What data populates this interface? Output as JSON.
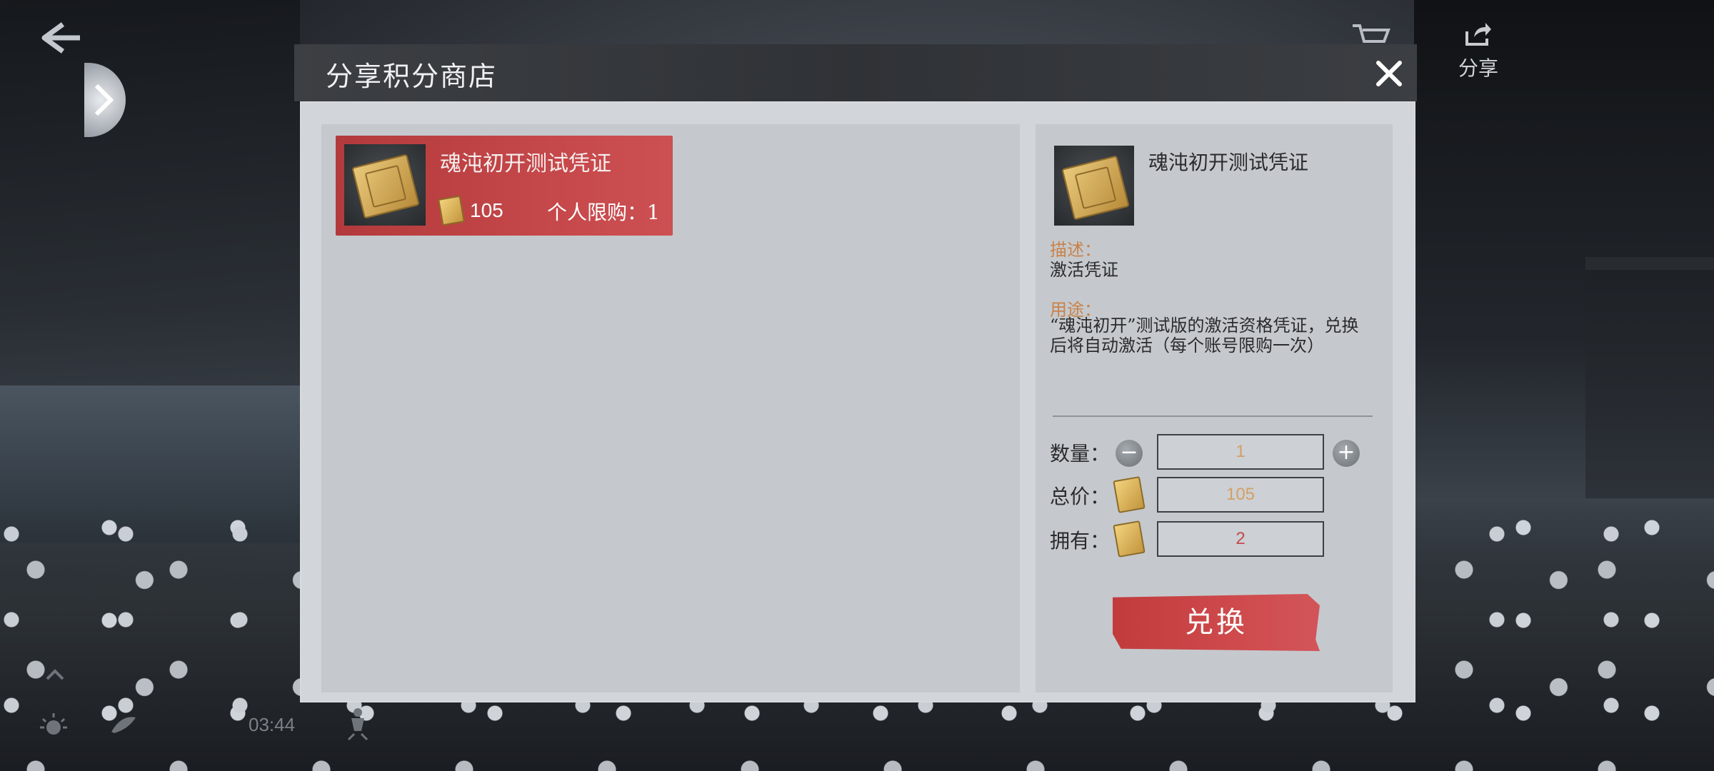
{
  "hud": {
    "share_label": "分享",
    "timer": "03:44"
  },
  "dialog": {
    "title": "分享积分商店",
    "items": [
      {
        "name": "魂沌初开测试凭证",
        "price": "105",
        "limit": "个人限购：1"
      }
    ]
  },
  "detail": {
    "name": "魂沌初开测试凭证",
    "desc_label": "描述：",
    "desc_text": "激活凭证",
    "use_label": "用途：",
    "use_text": "“魂沌初开”测试版的激活资格凭证，兑换后将自动激活（每个账号限购一次）",
    "quantity_label": "数量：",
    "quantity_value": "1",
    "total_label": "总价：",
    "total_value": "105",
    "owned_label": "拥有：",
    "owned_value": "2",
    "exchange_label": "兑换"
  },
  "colors": {
    "accent_red": "#c7494b",
    "label_orange": "#c9824a",
    "value_gold": "#d2a066"
  }
}
